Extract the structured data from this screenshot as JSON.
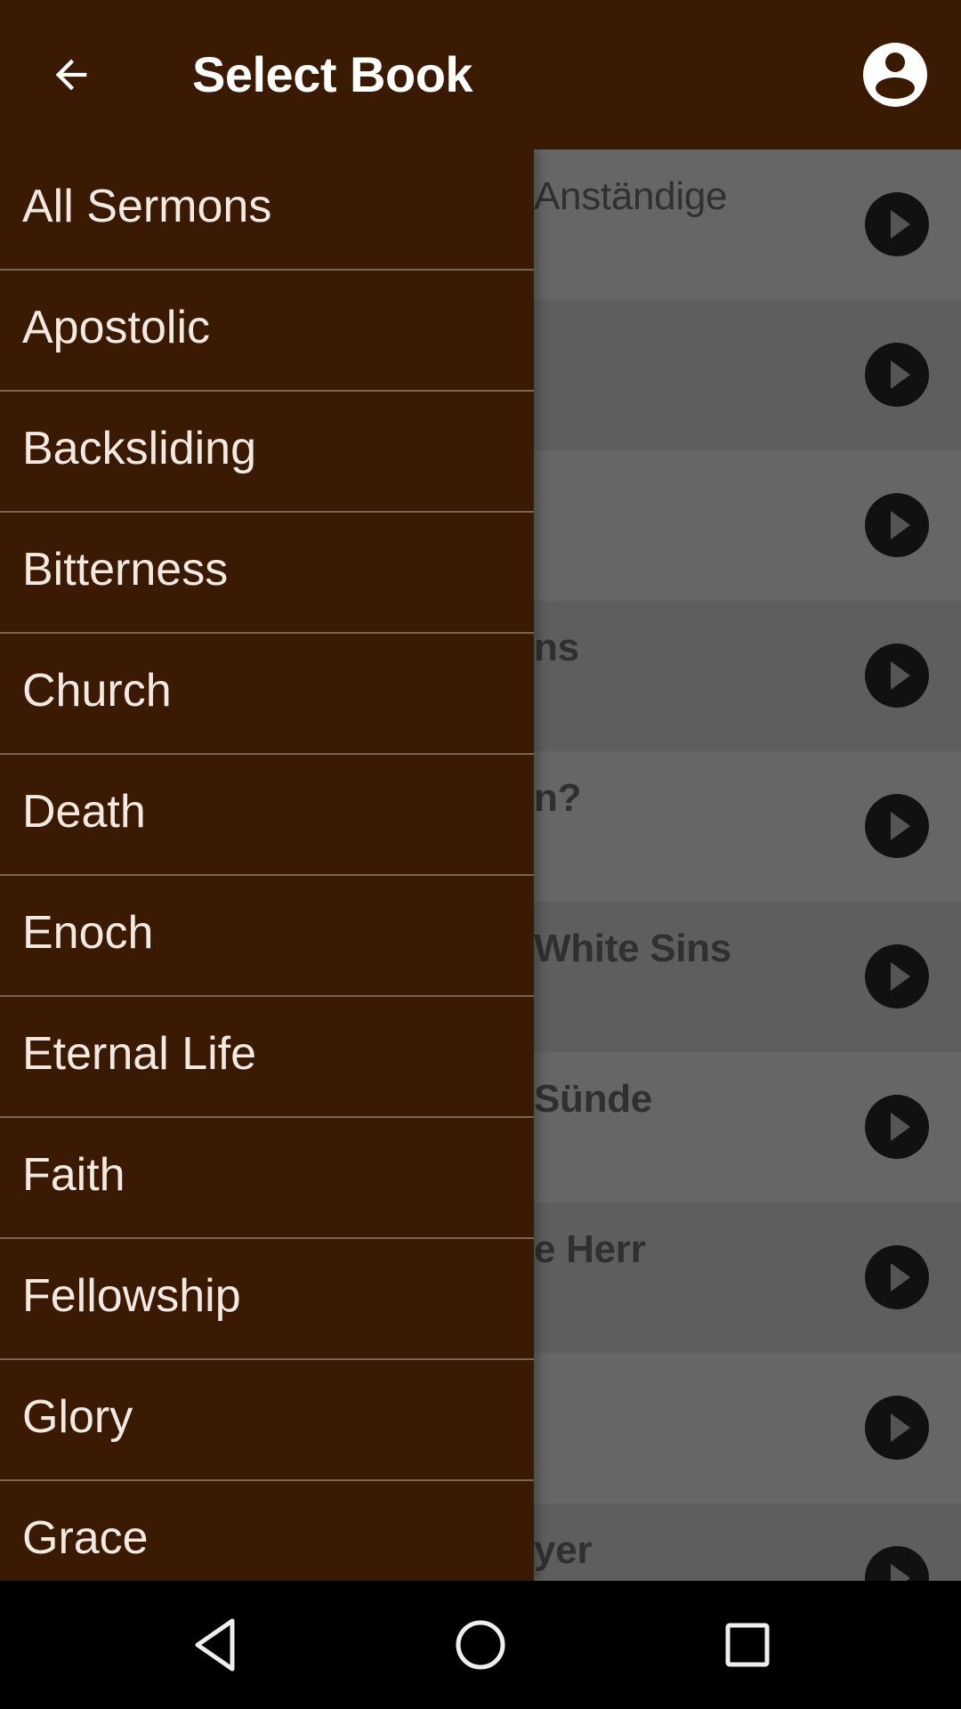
{
  "app_bar": {
    "title": "Select Book",
    "back_icon": "arrow-left-icon",
    "profile_icon": "account-circle-icon"
  },
  "drawer": {
    "items": [
      {
        "label": "All Sermons"
      },
      {
        "label": "Apostolic"
      },
      {
        "label": "Backsliding"
      },
      {
        "label": "Bitterness"
      },
      {
        "label": "Church"
      },
      {
        "label": "Death"
      },
      {
        "label": "Enoch"
      },
      {
        "label": "Eternal Life"
      },
      {
        "label": "Faith"
      },
      {
        "label": "Fellowship"
      },
      {
        "label": "Glory"
      },
      {
        "label": "Grace"
      }
    ]
  },
  "background_list": {
    "rows": [
      {
        "title_fragment": "Anständige",
        "bold": false
      },
      {
        "title_fragment": "",
        "bold": true
      },
      {
        "title_fragment": "",
        "bold": true
      },
      {
        "title_fragment": "ns",
        "bold": true
      },
      {
        "title_fragment": "n?",
        "bold": true
      },
      {
        "title_fragment": "White Sins",
        "bold": true
      },
      {
        "title_fragment": "Sünde",
        "bold": true
      },
      {
        "title_fragment": "e Herr",
        "bold": true
      },
      {
        "title_fragment": "",
        "bold": true
      },
      {
        "title_fragment": "yer",
        "bold": true
      }
    ],
    "play_icon": "play-circle-icon"
  },
  "nav_bar": {
    "back": "nav-back-icon",
    "home": "nav-home-icon",
    "recents": "nav-recents-icon"
  },
  "colors": {
    "primary": "#3a1a02",
    "divider": "#7a6450",
    "drawer_text": "#f3e9e3"
  }
}
